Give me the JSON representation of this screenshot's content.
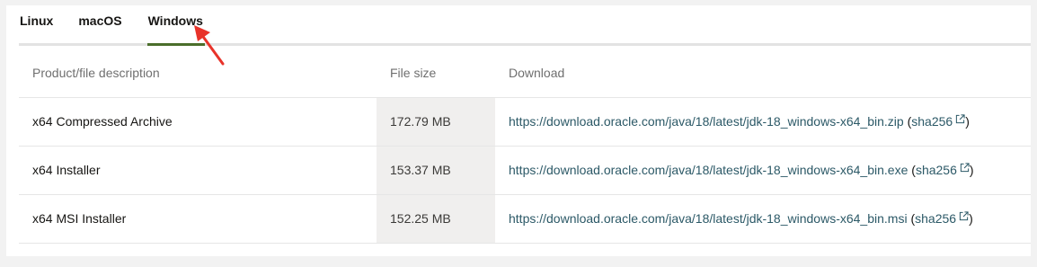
{
  "tabs": [
    {
      "label": "Linux"
    },
    {
      "label": "macOS"
    },
    {
      "label": "Windows",
      "active": true
    }
  ],
  "table": {
    "headers": [
      "Product/file description",
      "File size",
      "Download"
    ],
    "rows": [
      {
        "description": "x64 Compressed Archive",
        "size": "172.79 MB",
        "url": "https://download.oracle.com/java/18/latest/jdk-18_windows-x64_bin.zip",
        "sha_prefix": "(",
        "sha_label": "sha256",
        "sha_suffix": ")"
      },
      {
        "description": "x64 Installer",
        "size": "153.37 MB",
        "url": "https://download.oracle.com/java/18/latest/jdk-18_windows-x64_bin.exe",
        "sha_prefix": "(",
        "sha_label": "sha256",
        "sha_suffix": ")"
      },
      {
        "description": "x64 MSI Installer",
        "size": "152.25 MB",
        "url": "https://download.oracle.com/java/18/latest/jdk-18_windows-x64_bin.msi",
        "sha_prefix": "(",
        "sha_label": "sha256",
        "sha_suffix": ")"
      }
    ]
  },
  "colors": {
    "link": "#2c5967",
    "active_tab_underline": "#4a6e2b",
    "annotation_arrow": "#e8332a"
  },
  "icons": {
    "external_link": "external-link-icon",
    "annotation": "red-arrow-annotation"
  }
}
